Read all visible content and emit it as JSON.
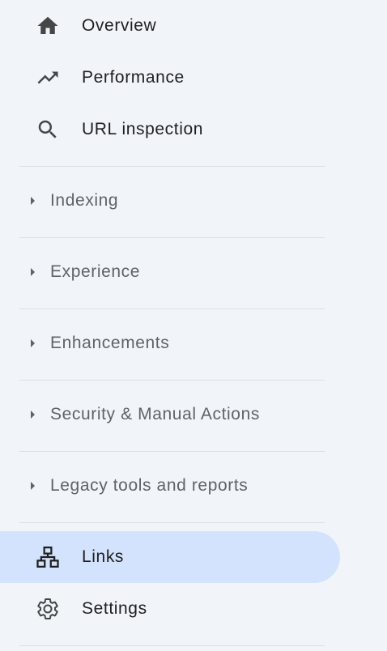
{
  "colors": {
    "background": "#f1f5fa",
    "active_background": "#d3e3fd",
    "primary_text": "#1f1f1f",
    "section_text": "#5f6368",
    "icon": "#444746",
    "divider": "#dcdfe3"
  },
  "nav_top": [
    {
      "label": "Overview",
      "icon": "home-icon"
    },
    {
      "label": "Performance",
      "icon": "trending-up-icon"
    },
    {
      "label": "URL inspection",
      "icon": "search-icon"
    }
  ],
  "sections": [
    {
      "label": "Indexing",
      "icon": "expand-arrow-icon"
    },
    {
      "label": "Experience",
      "icon": "expand-arrow-icon"
    },
    {
      "label": "Enhancements",
      "icon": "expand-arrow-icon"
    },
    {
      "label": "Security & Manual Actions",
      "icon": "expand-arrow-icon"
    },
    {
      "label": "Legacy tools and reports",
      "icon": "expand-arrow-icon"
    }
  ],
  "nav_bottom": [
    {
      "label": "Links",
      "icon": "sitemap-icon",
      "active": true
    },
    {
      "label": "Settings",
      "icon": "gear-icon",
      "active": false
    }
  ]
}
